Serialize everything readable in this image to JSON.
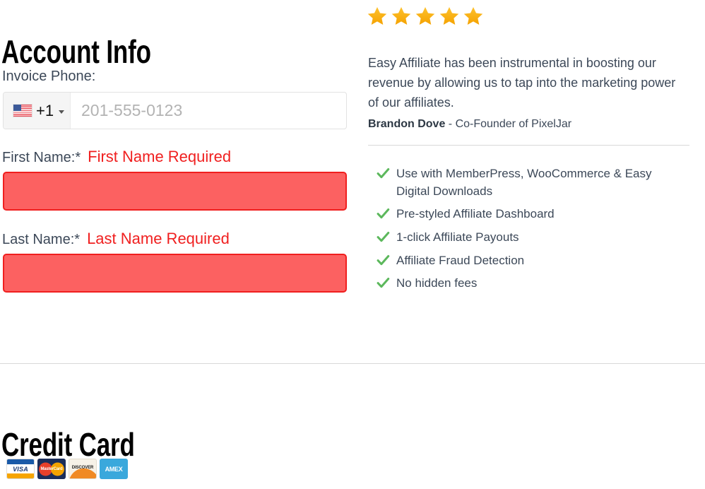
{
  "account_section": {
    "heading": "Account Info",
    "phone": {
      "label": "Invoice Phone:",
      "flag_icon": "us-flag-icon",
      "dial_code": "+1",
      "caret_icon": "chevron-down-icon",
      "placeholder": "201-555-0123",
      "value": ""
    },
    "first_name": {
      "label": "First Name:*",
      "error": "First Name Required",
      "value": "",
      "placeholder": ""
    },
    "last_name": {
      "label": "Last Name:*",
      "error": "Last Name Required",
      "value": "",
      "placeholder": ""
    }
  },
  "testimonial": {
    "rating": 5,
    "star_icon": "star-icon",
    "quote": "Easy Affiliate has been instrumental in boosting our revenue by allowing us to tap into the marketing power of our affiliates.",
    "author": "Brandon Dove",
    "author_role": " - Co-Founder of PixelJar"
  },
  "features": {
    "check_icon": "check-icon",
    "items": [
      "Use with MemberPress, WooCommerce & Easy Digital Downloads",
      "Pre-styled Affiliate Dashboard",
      "1-click Affiliate Payouts",
      "Affiliate Fraud Detection",
      "No hidden fees"
    ]
  },
  "credit_card_section": {
    "heading": "Credit Card",
    "accepted_cards": [
      {
        "name": "visa",
        "label": "VISA"
      },
      {
        "name": "mastercard",
        "label": "MasterCard"
      },
      {
        "name": "discover",
        "label": "DISCOVER"
      },
      {
        "name": "amex",
        "label": "AMEX"
      }
    ]
  },
  "colors": {
    "error_red": "#f01f1f",
    "error_fill": "#fc6161",
    "check_green": "#5cb85c",
    "star_gold": "#f9b31c",
    "text": "#3c4858",
    "divider": "#d8d8d8"
  }
}
